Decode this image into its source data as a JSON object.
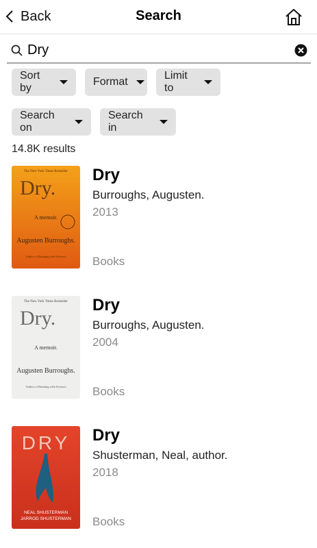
{
  "header": {
    "back_label": "Back",
    "title": "Search"
  },
  "search": {
    "value": "Dry"
  },
  "filters": {
    "sort_by": "Sort by",
    "format": "Format",
    "limit_to": "Limit to",
    "search_on": "Search on",
    "search_in": "Search in"
  },
  "results_count": "14.8K results",
  "results": [
    {
      "title": "Dry",
      "author": "Burroughs, Augusten.",
      "year": "2013",
      "format": "Books",
      "cover": {
        "header": "The New York Times Bestseller",
        "title": "Dry.",
        "subtitle": "A memoir.",
        "author": "Augusten Burroughs.",
        "tagline": "Author of Running with Scissors"
      }
    },
    {
      "title": "Dry",
      "author": "Burroughs, Augusten.",
      "year": "2004",
      "format": "Books",
      "cover": {
        "header": "The New York Times Bestseller",
        "title": "Dry.",
        "subtitle": "A memoir.",
        "author": "Augusten Burroughs.",
        "tagline": "Author of Running with Scissors"
      }
    },
    {
      "title": "Dry",
      "author": "Shusterman, Neal, author.",
      "year": "2018",
      "format": "Books",
      "cover": {
        "title": "DRY",
        "author1": "NEAL SHUSTERMAN",
        "author2": "JARROD SHUSTERMAN"
      }
    }
  ],
  "colors": {
    "chip_bg": "#e2e2e2",
    "muted_text": "#8a8a8a",
    "cover1_bg": "#e07a1a",
    "cover3_bg": "#d93a22"
  }
}
